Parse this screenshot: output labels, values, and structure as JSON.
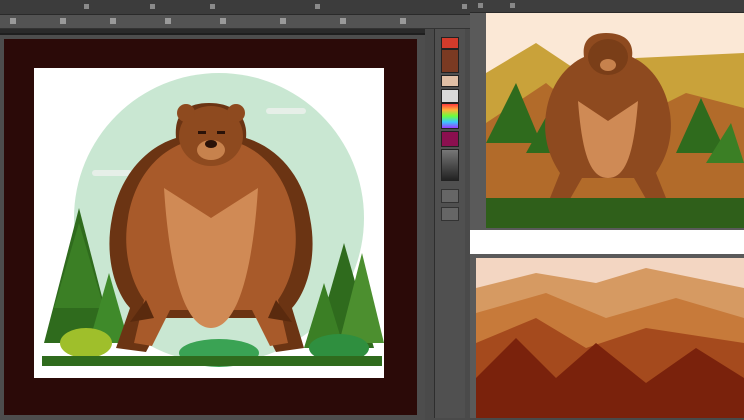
{
  "app": {
    "menu_icons": [
      "menu-grip-icon",
      "menu-grip-icon",
      "menu-grip-icon",
      "menu-grip-icon",
      "menu-grip-icon"
    ],
    "option_icons": [
      "tool-option-icon",
      "tool-option-icon",
      "tool-option-icon",
      "tool-option-icon",
      "tool-option-icon",
      "tool-option-icon",
      "tool-option-icon",
      "tool-option-icon"
    ]
  },
  "document": {
    "artwork": "bear-illustration",
    "background_color": "#2b0a08",
    "artboard_color": "#ffffff"
  },
  "palette": {
    "swatches": [
      "#d33b2b",
      "#7a3a22",
      "#e1c0a6",
      "#d9d9d9",
      "#4caf50",
      "#8b0f4f",
      "#4d4d4d"
    ]
  },
  "preview": {
    "top_thumbnail": "bear-in-forest",
    "bottom_thumbnail": "mountain-forest-landscape"
  }
}
